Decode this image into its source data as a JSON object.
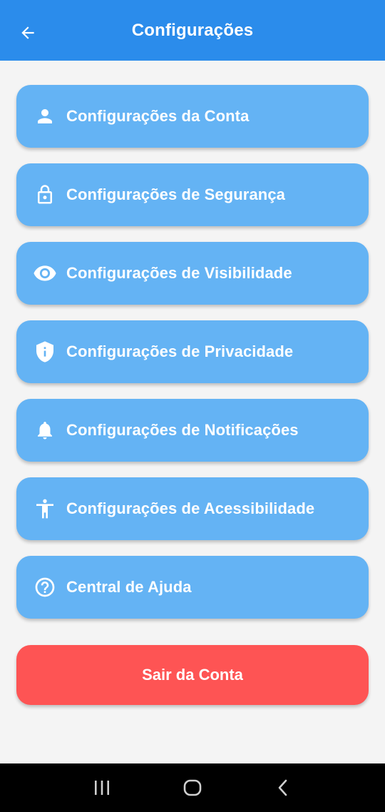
{
  "header": {
    "title": "Configurações",
    "back_icon": "arrow-left-icon"
  },
  "menu": {
    "items": [
      {
        "label": "Configurações da Conta",
        "icon": "person-icon"
      },
      {
        "label": "Configurações de Segurança",
        "icon": "lock-icon"
      },
      {
        "label": "Configurações de Visibilidade",
        "icon": "eye-icon"
      },
      {
        "label": "Configurações de Privacidade",
        "icon": "shield-info-icon"
      },
      {
        "label": "Configurações de Notificações",
        "icon": "bell-icon"
      },
      {
        "label": "Configurações de Acessibilidade",
        "icon": "accessibility-icon"
      },
      {
        "label": "Central de Ajuda",
        "icon": "help-circle-icon"
      }
    ]
  },
  "logout": {
    "label": "Sair da Conta"
  },
  "colors": {
    "appbar": "#2b8ceb",
    "menu_item": "#64b3f4",
    "logout": "#fe5454",
    "background": "#f4f4f4"
  },
  "system_nav": {
    "icons": [
      "recent-apps-icon",
      "home-icon",
      "back-icon"
    ]
  }
}
